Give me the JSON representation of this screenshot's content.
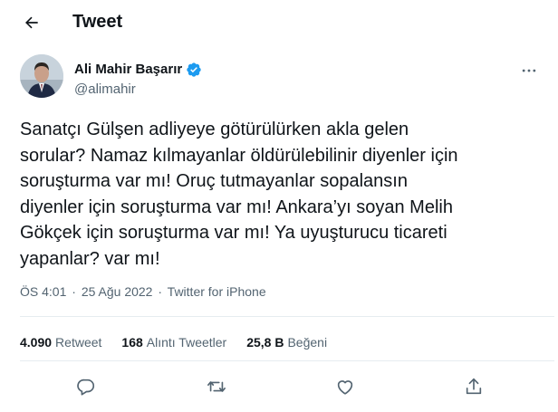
{
  "header": {
    "title": "Tweet"
  },
  "author": {
    "display_name": "Ali Mahir Başarır",
    "handle": "@alimahir"
  },
  "tweet": {
    "text": "Sanatçı Gülşen adliyeye götürülürken akla gelen\nsorular? Namaz kılmayanlar öldürülebilinir diyenler için\nsoruşturma var mı! Oruç tutmayanlar sopalansın\ndiyenler için soruşturma var mı! Ankara’yı soyan Melih\nGökçek için soruşturma var mı! Ya uyuşturucu ticareti\nyapanlar?  var mı!",
    "time": "ÖS 4:01",
    "separator": "·",
    "date": "25 Ağu 2022",
    "source": "Twitter for iPhone"
  },
  "stats": {
    "retweets": {
      "count": "4.090",
      "label": "Retweet"
    },
    "quotes": {
      "count": "168",
      "label": "Alıntı Tweetler"
    },
    "likes": {
      "count": "25,8 B",
      "label": "Beğeni"
    }
  },
  "colors": {
    "text": "#0f1419",
    "secondary": "#536471",
    "verified": "#1d9bf0",
    "divider": "#e6ecf0"
  },
  "icons": {
    "back": "arrow-left-icon",
    "verified": "verified-badge-icon",
    "more": "more-horizontal-icon",
    "reply": "reply-icon",
    "retweet": "retweet-icon",
    "like": "heart-icon",
    "share": "share-icon"
  }
}
